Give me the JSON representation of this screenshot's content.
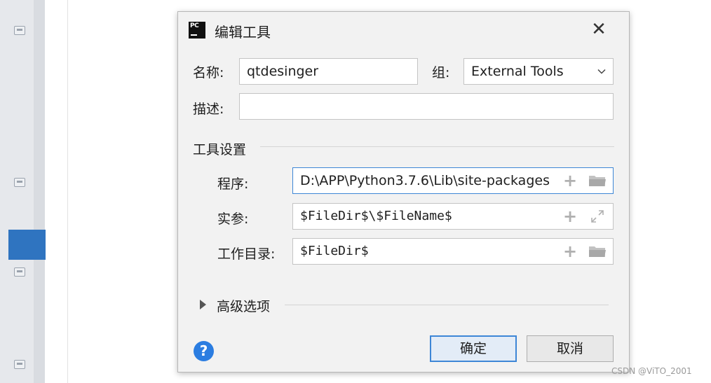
{
  "dialog": {
    "title": "编辑工具",
    "app_icon_text": "PC",
    "close_glyph": "✕"
  },
  "form": {
    "name_label": "名称:",
    "name_value": "qtdesinger",
    "group_label": "组:",
    "group_value": "External Tools",
    "desc_label": "描述:",
    "desc_value": ""
  },
  "tool_settings": {
    "section_label": "工具设置",
    "program_label": "程序:",
    "program_value": "D:\\APP\\Python3.7.6\\Lib\\site-packages",
    "args_label": "实参:",
    "args_value": "$FileDir$\\$FileName$",
    "workdir_label": "工作目录:",
    "workdir_value": "$FileDir$",
    "plus_glyph": "+"
  },
  "advanced": {
    "label": "高级选项"
  },
  "buttons": {
    "help_glyph": "?",
    "ok_label": "确定",
    "cancel_label": "取消"
  },
  "watermark": "CSDN @ViTO_2001",
  "colors": {
    "accent": "#3d86d6",
    "sidebar_selected": "#2f74c0",
    "help": "#2b7de1"
  }
}
